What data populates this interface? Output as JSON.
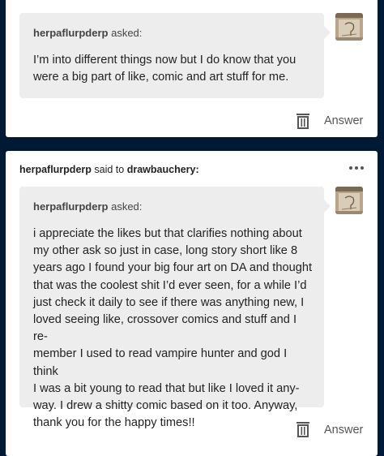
{
  "post1": {
    "asker_name": "herpaflurpderp",
    "asked_label": "asked:",
    "question": "I’m into different things now but I do know that you were a big part of like, comic and art stuff for me.",
    "answer_label": "Answer"
  },
  "post2": {
    "reblogger": "herpaflurpderp",
    "said_to": "said to",
    "target": "drawbauchery:",
    "asker_name": "herpaflurpderp",
    "asked_label": "asked:",
    "question": "i appreciate the likes but that clarifies nothing about\nmy other ask so just in case, long story short like 8\nyears ago I found your big four art on DA and thought\nthat was the coolest shit I’d ever seen, for a while I’d\njust check it daily to see if there was anything new, I\nloved seeing like, crossover comics and stuff and I re-\nmember I used to read vampire hunter and god I think\nI was a bit young to read that but like I loved it any-\nway. I drew a shitty comic based on it too. Anyway,\nthank you for the happy times!!",
    "answer_label": "Answer"
  },
  "icons": {
    "trash": "trash-icon",
    "more": "more-icon",
    "avatar": "avatar-sketch"
  },
  "colors": {
    "background": "#001935",
    "card": "#ffffff",
    "bubble": "#ededed"
  }
}
